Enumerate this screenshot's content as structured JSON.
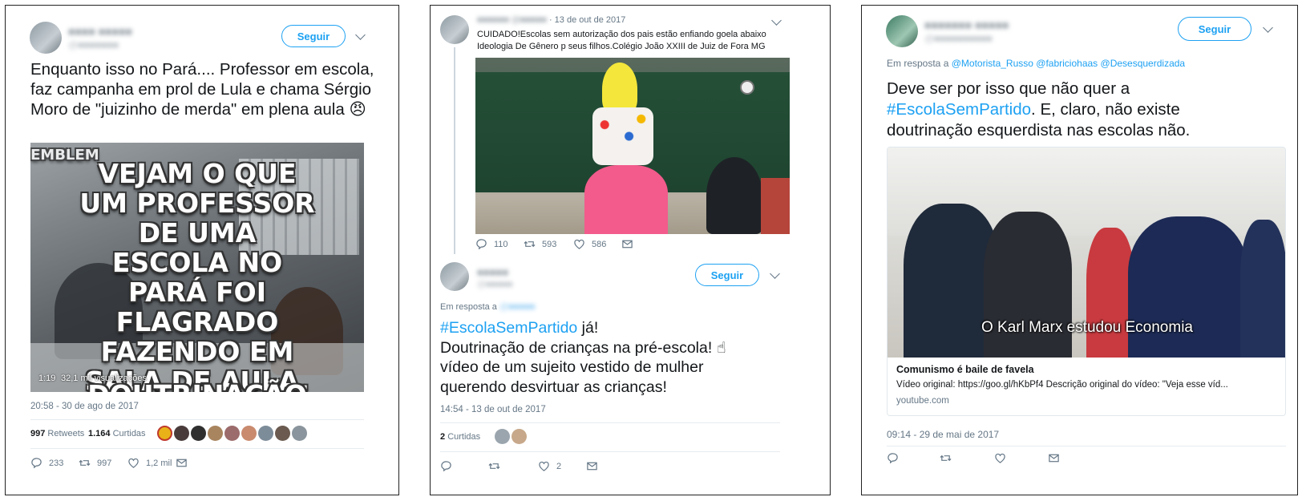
{
  "tweet1": {
    "text": "Enquanto isso no Pará.... Professor em escola, faz campanha em prol de Lula e chama Sérgio Moro de \"juizinho de merda\" em plena aula 😠",
    "follow_label": "Seguir",
    "video_overlay": "VEJAM O QUE UM PROFESSOR DE UMA ESCOLA NO PARÁ FOI FLAGRADO FAZENDO EM SALA DE AULA,",
    "video_overlay_cut": "DOUTRINAÇÃO",
    "video_top_text": "EMBLEM",
    "video_duration": "1:19",
    "video_views": "32,1 mil visualizações",
    "timestamp": "20:58 - 30 de ago de 2017",
    "retweets_count": "997",
    "retweets_label": "Retweets",
    "likes_count": "1.164",
    "likes_label": "Curtidas",
    "reply_count": "233",
    "retweet_action_count": "997",
    "like_action_count": "1,2 mil"
  },
  "tweet2_parent": {
    "date": "· 13 de out de 2017",
    "text": "CUIDADO!Escolas sem autorização dos pais estão enfiando goela abaixo Ideologia De Gênero p seus filhos.Colégio João XXIII de Juiz de Fora MG",
    "reply_count": "110",
    "retweet_count": "593",
    "like_count": "586"
  },
  "tweet2": {
    "follow_label": "Seguir",
    "in_reply_label": "Em resposta a",
    "hashtag": "#EscolaSemPartido",
    "text_after_hashtag": " já!",
    "line2": "Doutrinação de crianças na pré-escola! ☝",
    "line3": "vídeo de um sujeito vestido de mulher",
    "line4": "querendo desvirtuar as crianças!",
    "timestamp": "14:54 - 13 de out de 2017",
    "likes_count": "2",
    "likes_label": "Curtidas",
    "like_action_count": "2"
  },
  "tweet3": {
    "follow_label": "Seguir",
    "in_reply_label": "Em resposta a",
    "mentions": [
      "@Motorista_Russo",
      "@fabriciohaas",
      "@Desesquerdizada"
    ],
    "line1": "Deve ser por isso que não quer a",
    "hashtag": "#EscolaSemPartido",
    "line2_rest": ". E, claro, não existe",
    "line3": "doutrinação esquerdista nas escolas não.",
    "video_caption": "O Karl Marx estudou Economia",
    "card_title": "Comunismo é baile de favela",
    "card_desc": "Vídeo original: https://goo.gl/hKbPf4 Descrição original do vídeo: \"Veja esse víd...",
    "card_domain": "youtube.com",
    "timestamp": "09:14 - 29 de mai de 2017"
  },
  "colors": {
    "link": "#1da1f2",
    "gray": "#657786",
    "separator": "#e6ecf0"
  }
}
